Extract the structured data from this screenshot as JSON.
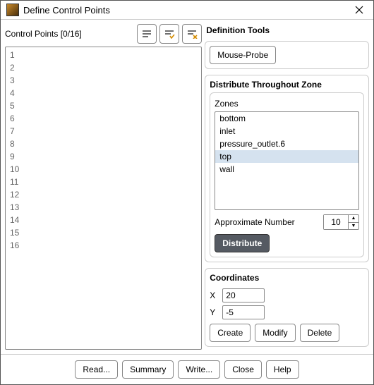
{
  "window": {
    "title": "Define Control Points"
  },
  "left": {
    "header": "Control Points  [0/16]",
    "rows": [
      "1",
      "2",
      "3",
      "4",
      "5",
      "6",
      "7",
      "8",
      "9",
      "10",
      "11",
      "12",
      "13",
      "14",
      "15",
      "16"
    ]
  },
  "right": {
    "title": "Definition Tools",
    "mouse_probe": "Mouse-Probe",
    "distribute_title": "Distribute Throughout Zone",
    "zones_title": "Zones",
    "zones": [
      "bottom",
      "inlet",
      "pressure_outlet.6",
      "top",
      "wall"
    ],
    "zones_selected_index": 3,
    "approx_label": "Approximate Number",
    "approx_value": "10",
    "distribute_btn": "Distribute",
    "coords_title": "Coordinates",
    "x_label": "X",
    "x_value": "20",
    "y_label": "Y",
    "y_value": "-5",
    "create": "Create",
    "modify": "Modify",
    "delete": "Delete"
  },
  "footer": {
    "read": "Read...",
    "summary": "Summary",
    "write": "Write...",
    "close": "Close",
    "help": "Help"
  }
}
